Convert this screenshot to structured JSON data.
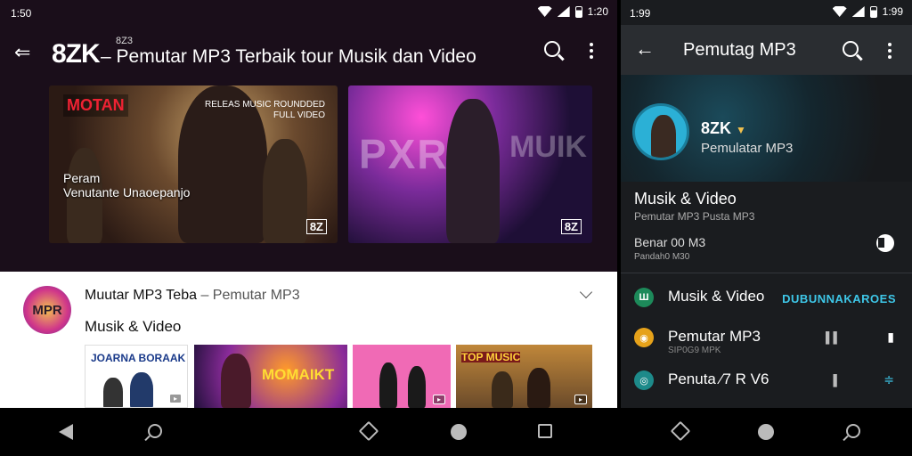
{
  "left": {
    "status": {
      "time": "1:50",
      "clock": "1:20"
    },
    "appbar": {
      "small_label": "8Z3",
      "title": "8ZK",
      "subtitle": "– Pemutar MP3 Terbaik tour Musik dan Video"
    },
    "thumbs": [
      {
        "brand": "MOTAN",
        "tag": "RELEAS MUSIC ROUNDDED\nFULL VIDEO",
        "caption_line1": "Peram",
        "caption_line2": "Venutante Unaoepanjo",
        "watermark": "8Z"
      },
      {
        "big_text": "PXR",
        "big_text2": "MUIK",
        "watermark": "8Z"
      }
    ],
    "card": {
      "logo_text": "MPR",
      "title": "Muutar MP3 Teba",
      "title_suffix": " – Pemutar MP3",
      "subtitle": "Musik & Video",
      "minis": [
        {
          "title": "JOARNA BORAAK"
        },
        {
          "title": "MOMAIKT"
        },
        {
          "title": ""
        },
        {
          "title": "TOP MUSIC"
        }
      ]
    }
  },
  "right": {
    "status": {
      "time": "1:99",
      "clock": "1:99"
    },
    "appbar": {
      "title": "Pemutag MP3"
    },
    "profile": {
      "name": "8ZK",
      "desc": "Pemulatar MP3"
    },
    "section": {
      "title": "Musik & Video",
      "subtitle": "Pemutar MP3 Pusta MP3",
      "row_title": "Benar 00 M3",
      "row_sub": "Pandah0 M30"
    },
    "items": [
      {
        "label": "Musik & Video",
        "sub": "",
        "accent": "DUBUNNAKAROES",
        "dot_color": "#1d8a5a",
        "dot_text": "Ш"
      },
      {
        "label": "Pemutar MP3",
        "sub": "SIP0G9 MPK",
        "r1": "▌▌",
        "r2": "▮",
        "dot_color": "#e6a21a",
        "dot_text": "◉"
      },
      {
        "label": "Penuta ⁄7 R V6",
        "sub": "",
        "r1": "▌",
        "r2": "≑",
        "dot_color": "#1d8a8a",
        "dot_text": "◎"
      }
    ]
  },
  "colors": {
    "accent": "#3ec7e8",
    "left_bg": "#1a0e1a",
    "right_bg": "#1a1c1f"
  }
}
